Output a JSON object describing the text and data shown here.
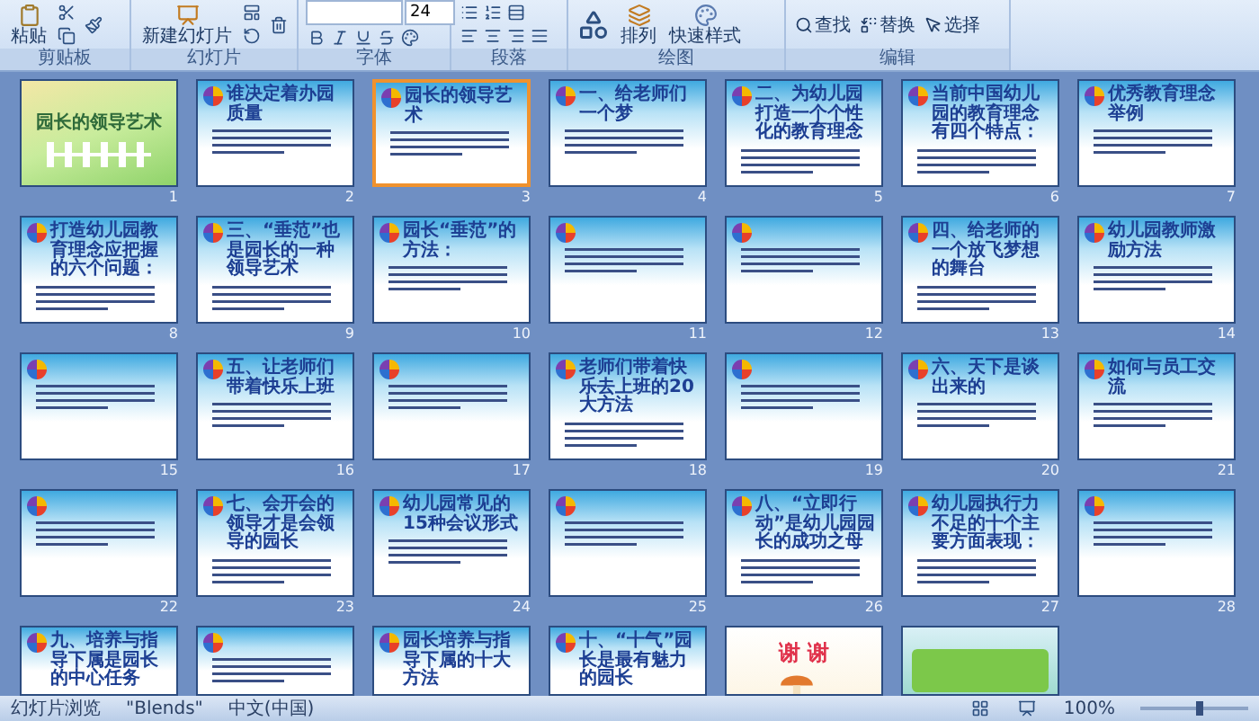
{
  "ribbon": {
    "groups": [
      {
        "label": "剪贴板",
        "kind": "clipboard",
        "buttons": [
          "粘贴"
        ]
      },
      {
        "label": "幻灯片",
        "kind": "slides",
        "buttons": [
          "新建幻灯片"
        ]
      },
      {
        "label": "字体",
        "kind": "font",
        "font_size": "24"
      },
      {
        "label": "段落",
        "kind": "paragraph"
      },
      {
        "label": "绘图",
        "kind": "drawing",
        "buttons": [
          "排列",
          "快速样式"
        ]
      },
      {
        "label": "编辑",
        "kind": "editing",
        "buttons": [
          "查找",
          "替换",
          "选择"
        ]
      }
    ]
  },
  "slides": [
    {
      "number": "1",
      "kind": "cover",
      "title": "园长的领导艺术",
      "selected": false
    },
    {
      "number": "2",
      "kind": "content",
      "title": "谁决定着办园质量",
      "selected": false
    },
    {
      "number": "3",
      "kind": "content",
      "title": "园长的领导艺术",
      "selected": true
    },
    {
      "number": "4",
      "kind": "content",
      "title": "一、给老师们一个梦",
      "selected": false
    },
    {
      "number": "5",
      "kind": "content",
      "title": "二、为幼儿园打造一个个性化的教育理念",
      "selected": false
    },
    {
      "number": "6",
      "kind": "content",
      "title": "当前中国幼儿园的教育理念有四个特点：",
      "selected": false
    },
    {
      "number": "7",
      "kind": "content",
      "title": "优秀教育理念举例",
      "selected": false
    },
    {
      "number": "8",
      "kind": "content",
      "title": "打造幼儿园教育理念应把握的六个问题：",
      "selected": false
    },
    {
      "number": "9",
      "kind": "content",
      "title": "三、“垂范”也是园长的一种领导艺术",
      "selected": false
    },
    {
      "number": "10",
      "kind": "content",
      "title": "园长“垂范”的方法：",
      "selected": false
    },
    {
      "number": "11",
      "kind": "content",
      "selected": false
    },
    {
      "number": "12",
      "kind": "content",
      "selected": false
    },
    {
      "number": "13",
      "kind": "content",
      "title": "四、给老师的一个放飞梦想的舞台",
      "selected": false
    },
    {
      "number": "14",
      "kind": "content",
      "title": "幼儿园教师激励方法",
      "selected": false
    },
    {
      "number": "15",
      "kind": "content",
      "selected": false
    },
    {
      "number": "16",
      "kind": "content",
      "title": "五、让老师们带着快乐上班",
      "selected": false
    },
    {
      "number": "17",
      "kind": "content",
      "selected": false
    },
    {
      "number": "18",
      "kind": "content",
      "title": "老师们带着快乐去上班的20大方法",
      "selected": false
    },
    {
      "number": "19",
      "kind": "content",
      "selected": false
    },
    {
      "number": "20",
      "kind": "content",
      "title": "六、天下是谈出来的",
      "selected": false
    },
    {
      "number": "21",
      "kind": "content",
      "title": "如何与员工交流",
      "selected": false
    },
    {
      "number": "22",
      "kind": "content",
      "selected": false
    },
    {
      "number": "23",
      "kind": "content",
      "title": "七、会开会的领导才是会领导的园长",
      "selected": false
    },
    {
      "number": "24",
      "kind": "content",
      "title": "幼儿园常见的15种会议形式",
      "selected": false
    },
    {
      "number": "25",
      "kind": "content",
      "selected": false
    },
    {
      "number": "26",
      "kind": "content",
      "title": "八、“立即行动”是幼儿园园长的成功之母",
      "selected": false
    },
    {
      "number": "27",
      "kind": "content",
      "title": "幼儿园执行力不足的十个主要方面表现：",
      "selected": false
    },
    {
      "number": "28",
      "kind": "content",
      "selected": false
    },
    {
      "kind": "content",
      "title": "九、培养与指导下属是园长的中心任务",
      "selected": false
    },
    {
      "kind": "content",
      "selected": false
    },
    {
      "kind": "content",
      "title": "园长培养与指导下属的十大方法",
      "selected": false
    },
    {
      "kind": "content",
      "title": "十、“十气”园长是最有魅力的园长",
      "selected": false
    },
    {
      "kind": "thanks",
      "title": "谢 谢",
      "selected": false
    },
    {
      "kind": "contact",
      "selected": false
    }
  ],
  "status_bar": {
    "view": "幻灯片浏览",
    "theme": "\"Blends\"",
    "language": "中文(中国)",
    "zoom": "100%",
    "zoom_slider": {
      "level": 0.55
    }
  }
}
